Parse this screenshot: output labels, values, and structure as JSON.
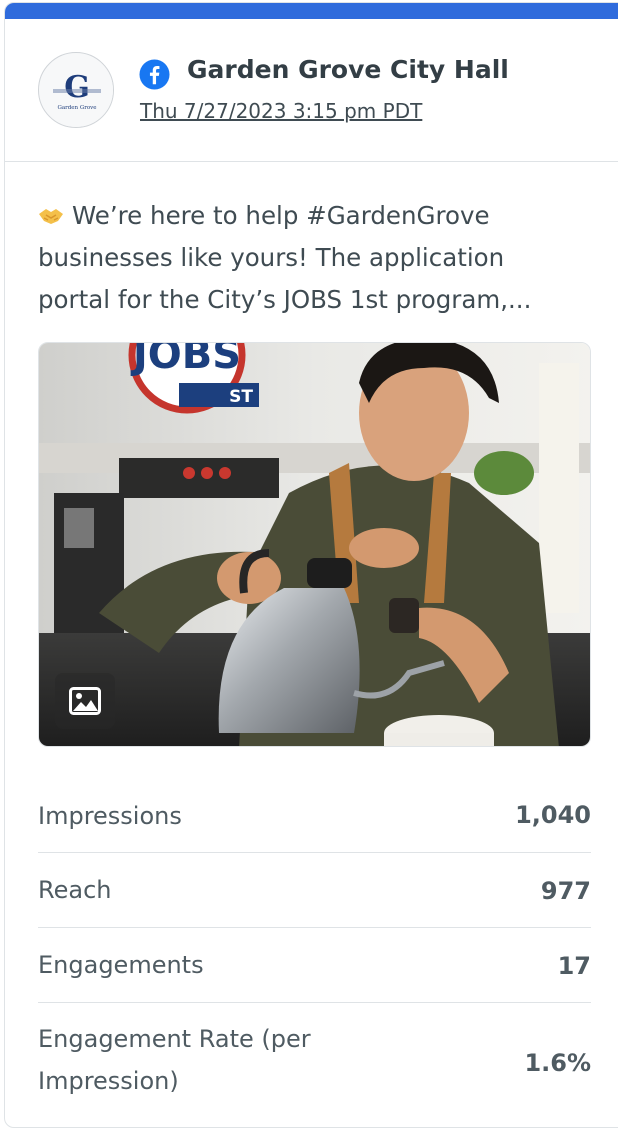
{
  "post": {
    "page_name": "Garden Grove City Hall",
    "timestamp": "Thu 7/27/2023 3:15 pm PDT",
    "network": "facebook",
    "avatar_initial": "G",
    "avatar_caption": "Garden Grove",
    "text_lines": [
      "We’re here to help #GardenGrove",
      "businesses like yours! The application",
      "portal for the City’s JOBS 1st program,..."
    ],
    "emoji": "handshake-emoji",
    "image_logo_text": "JOBS",
    "image_logo_sub": "ST",
    "image_badge_icon": "image-icon"
  },
  "metrics": [
    {
      "label": "Impressions",
      "value": "1,040"
    },
    {
      "label": "Reach",
      "value": "977"
    },
    {
      "label": "Engagements",
      "value": "17"
    },
    {
      "label": "Engagement Rate (per Impression)",
      "label_line1": "Engagement Rate (per",
      "label_line2": "Impression)",
      "value": "1.6%"
    }
  ],
  "colors": {
    "accent": "#2f6bdc",
    "facebook": "#1877f2",
    "text": "#3f4b52",
    "divider": "#dfe3e6"
  }
}
